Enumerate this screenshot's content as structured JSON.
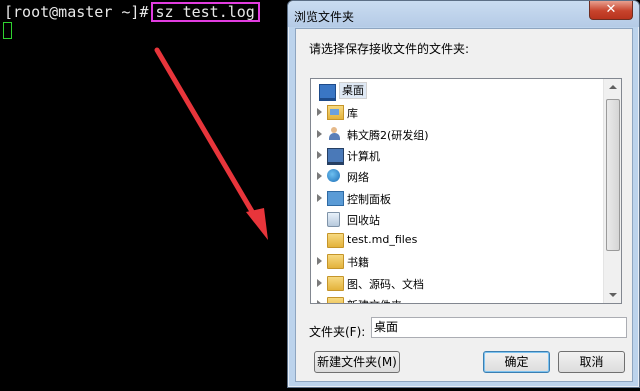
{
  "terminal": {
    "prompt": "[root@master ~]#",
    "command": "sz test.log"
  },
  "dialog": {
    "title": "浏览文件夹",
    "close_label": "✕",
    "instruction": "请选择保存接收文件的文件夹:",
    "tree": {
      "items": [
        {
          "label": "桌面",
          "icon": "desktop-icon",
          "expandable": false,
          "selected": true
        },
        {
          "label": "库",
          "icon": "library-icon",
          "expandable": true
        },
        {
          "label": "韩文腾2(研发组)",
          "icon": "user-icon",
          "expandable": true
        },
        {
          "label": "计算机",
          "icon": "computer-icon",
          "expandable": true
        },
        {
          "label": "网络",
          "icon": "network-icon",
          "expandable": true
        },
        {
          "label": "控制面板",
          "icon": "control-panel-icon",
          "expandable": true
        },
        {
          "label": "回收站",
          "icon": "recycle-bin-icon",
          "expandable": false
        },
        {
          "label": "test.md_files",
          "icon": "folder-icon",
          "expandable": false
        },
        {
          "label": "书籍",
          "icon": "folder-icon",
          "expandable": true
        },
        {
          "label": "图、源码、文档",
          "icon": "folder-icon",
          "expandable": true
        },
        {
          "label": "新建文件夹",
          "icon": "folder-icon",
          "expandable": true
        }
      ]
    },
    "folder_label": "文件夹(F):",
    "folder_value": "桌面",
    "new_folder_button": "新建文件夹(M)",
    "ok_button": "确定",
    "cancel_button": "取消"
  },
  "colors": {
    "command_highlight": "#e23de0",
    "cursor": "#2fd22f",
    "arrow": "#e8353b"
  }
}
